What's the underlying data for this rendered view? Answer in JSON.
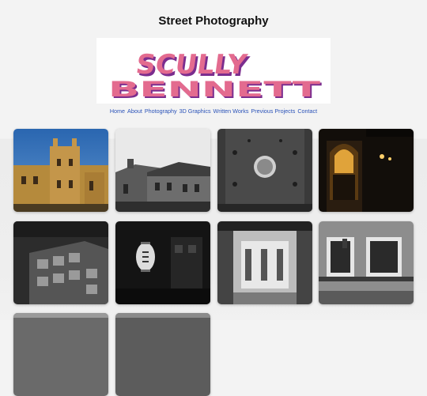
{
  "page": {
    "title": "Street Photography"
  },
  "logo": {
    "line1": "SCULLY",
    "line2": "BENNETT"
  },
  "nav": [
    {
      "label": "Home"
    },
    {
      "label": "About"
    },
    {
      "label": "Photography"
    },
    {
      "label": "3D Graphics"
    },
    {
      "label": "Written Works"
    },
    {
      "label": "Previous Projects"
    },
    {
      "label": "Contact"
    }
  ],
  "gallery": {
    "photos": [
      {
        "subject": "castle-tower-photo"
      },
      {
        "subject": "rooftops-photo"
      },
      {
        "subject": "metal-door-photo"
      },
      {
        "subject": "night-doorway-photo"
      },
      {
        "subject": "building-photo"
      },
      {
        "subject": "lantern-photo"
      },
      {
        "subject": "shop-interior-photo"
      },
      {
        "subject": "balcony-photo"
      },
      {
        "subject": "photo-9"
      },
      {
        "subject": "photo-10"
      }
    ]
  }
}
